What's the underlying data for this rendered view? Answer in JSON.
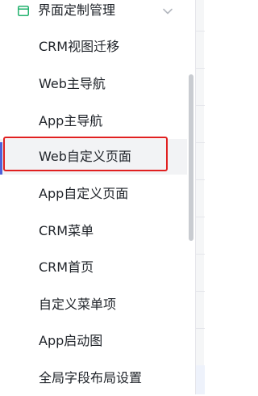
{
  "sidebar": {
    "group": {
      "label": "界面定制管理",
      "icon": "layout-icon",
      "expand_icon": "chevron-down-icon"
    },
    "items": [
      {
        "label": "CRM视图迁移"
      },
      {
        "label": "Web主导航"
      },
      {
        "label": "App主导航"
      },
      {
        "label": "Web自定义页面",
        "active": true
      },
      {
        "label": "App自定义页面"
      },
      {
        "label": "CRM菜单"
      },
      {
        "label": "CRM首页"
      },
      {
        "label": "自定义菜单项"
      },
      {
        "label": "App启动图"
      },
      {
        "label": "全局字段布局设置"
      }
    ]
  },
  "colors": {
    "accent": "#4e61d8",
    "icon_green": "#23b26e",
    "highlight": "#e02020",
    "text": "#1f2329",
    "active_bg": "#f2f3f5"
  }
}
